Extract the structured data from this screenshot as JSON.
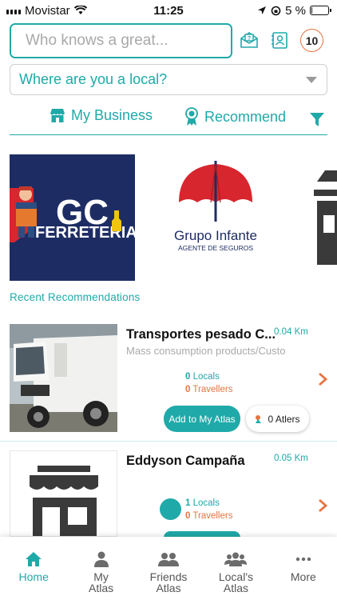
{
  "status_bar": {
    "carrier": "Movistar",
    "time": "11:25",
    "battery": "5 %",
    "battery_level": 0.05
  },
  "search": {
    "placeholder": "Who knows a great...",
    "notification_count": "10"
  },
  "location": {
    "placeholder": "Where are you a local?"
  },
  "tabs": {
    "my_business": "My Business",
    "recommend": "Recommend"
  },
  "featured": {
    "gc": {
      "line1": "GC",
      "line2": "FERRETERIA"
    },
    "grupo_infante": {
      "name": "Grupo Infante",
      "tagline": "AGENTE DE SEGUROS"
    }
  },
  "section_title": "Recent Recommendations",
  "recommendations": [
    {
      "name": "Transportes pesado C...",
      "distance": "0.04 Km",
      "category": "Mass consumption products/Custo",
      "locals_count": "0",
      "locals_label": "Locals",
      "travellers_count": "0",
      "travellers_label": "Travellers",
      "add_label": "Add to My Atlas",
      "atlers_label": "0 Atlers"
    },
    {
      "name": "Eddyson Campaña",
      "distance": "0.05 Km",
      "locals_count": "1",
      "locals_label": "Locals",
      "travellers_count": "0",
      "travellers_label": "Travellers"
    }
  ],
  "nav": [
    {
      "label": "Home",
      "icon": "home-icon"
    },
    {
      "label": "My\nAtlas",
      "icon": "person-icon"
    },
    {
      "label": "Friends\nAtlas",
      "icon": "friends-icon"
    },
    {
      "label": "Local's\nAtlas",
      "icon": "group-icon"
    },
    {
      "label": "More",
      "icon": "more-icon"
    }
  ],
  "colors": {
    "accent": "#20a9a9",
    "orange": "#e57441",
    "brand_navy": "#1d2d64",
    "brand_red": "#d7262e"
  }
}
